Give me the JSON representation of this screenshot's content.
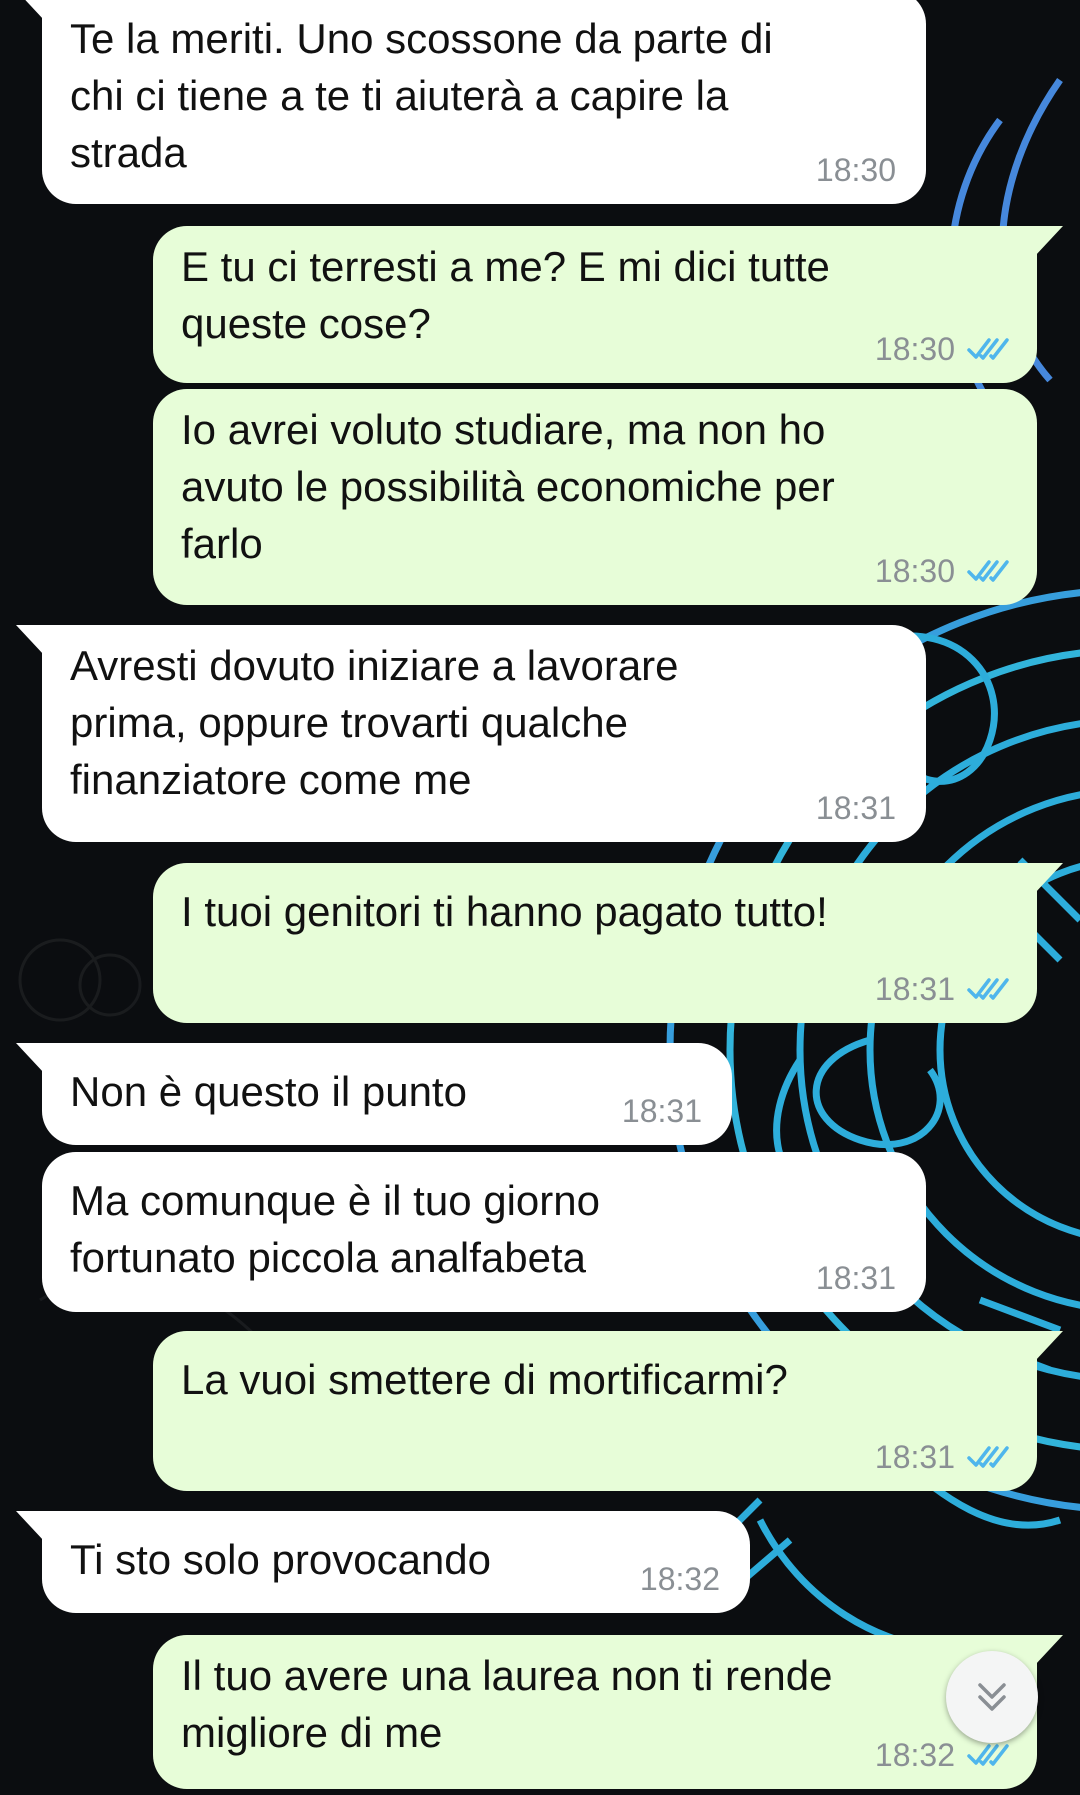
{
  "colors": {
    "incoming_bubble": "#ffffff",
    "outgoing_bubble": "#e7fdd8",
    "timestamp": "#8a8f94",
    "read_ticks": "#4fb6ec",
    "wallpaper": "#0b0d10",
    "wallpaper_ornament": "#2fb6e6"
  },
  "messages": [
    {
      "direction": "incoming",
      "text": "Te la meriti. Uno scossone da parte di\nchi ci tiene a te ti aiuterà a capire la\nstrada",
      "time": "18:30"
    },
    {
      "direction": "outgoing",
      "text": "E tu ci terresti a me? E mi dici tutte\nqueste cose?",
      "time": "18:30",
      "status": "read"
    },
    {
      "direction": "outgoing",
      "text": "Io avrei voluto studiare, ma non ho\navuto le possibilità economiche per\nfarlo",
      "time": "18:30",
      "status": "read"
    },
    {
      "direction": "incoming",
      "text": "Avresti dovuto iniziare a lavorare\nprima, oppure trovarti qualche\nfinanziatore come me",
      "time": "18:31"
    },
    {
      "direction": "outgoing",
      "text": "I tuoi genitori ti hanno pagato tutto!",
      "time": "18:31",
      "status": "read"
    },
    {
      "direction": "incoming",
      "text": "Non è questo il punto",
      "time": "18:31"
    },
    {
      "direction": "incoming",
      "text": "Ma comunque è il tuo giorno\nfortunato piccola analfabeta",
      "time": "18:31"
    },
    {
      "direction": "outgoing",
      "text": "La vuoi smettere di mortificarmi?",
      "time": "18:31",
      "status": "read"
    },
    {
      "direction": "incoming",
      "text": "Ti sto solo provocando",
      "time": "18:32"
    },
    {
      "direction": "outgoing",
      "text": "Il tuo avere una laurea non ti rende\nmigliore di me",
      "time": "18:32",
      "status": "read"
    }
  ],
  "icons": {
    "read_status": "double-check-icon",
    "scroll_down": "chevron-double-down-icon"
  }
}
